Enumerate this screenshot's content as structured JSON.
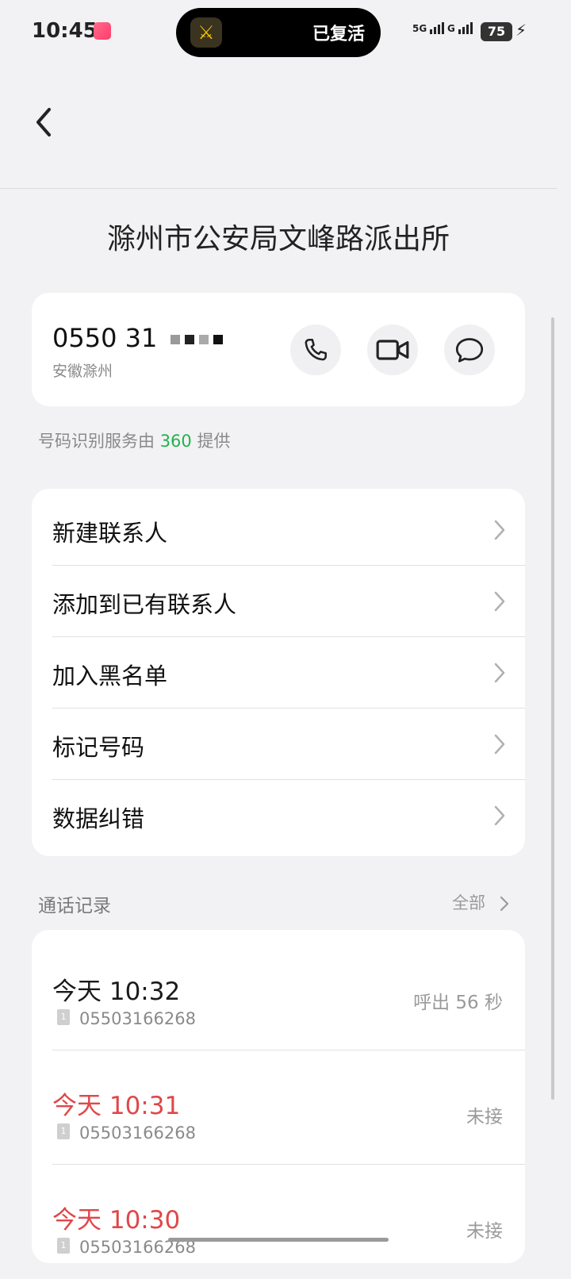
{
  "status_bar": {
    "time": "10:45",
    "signal1_label": "5G",
    "signal2_label": "G",
    "battery": "75"
  },
  "dynamic_island": {
    "icon": "sword-game-icon",
    "text": "已复活"
  },
  "header": {
    "title": "滁州市公安局文峰路派出所"
  },
  "number_card": {
    "number": "0550 31",
    "region": "安徽滁州",
    "actions": [
      "phone-icon",
      "video-icon",
      "message-icon"
    ]
  },
  "provider_note": {
    "prefix": "号码识别服务由",
    "brand": "360",
    "suffix": "提供"
  },
  "menu": [
    {
      "label": "新建联系人"
    },
    {
      "label": "添加到已有联系人"
    },
    {
      "label": "加入黑名单"
    },
    {
      "label": "标记号码"
    },
    {
      "label": "数据纠错"
    }
  ],
  "call_log": {
    "section_title": "通话记录",
    "all_label": "全部",
    "items": [
      {
        "time": "今天 10:32",
        "sim": "1",
        "number": "05503166268",
        "status": "呼出 56 秒",
        "missed": false
      },
      {
        "time": "今天 10:31",
        "sim": "1",
        "number": "05503166268",
        "status": "未接",
        "missed": true
      },
      {
        "time": "今天 10:30",
        "sim": "1",
        "number": "05503166268",
        "status": "未接",
        "missed": true
      }
    ]
  },
  "colors": {
    "accent_green": "#22b24c",
    "missed_red": "#e0474a",
    "background": "#f2f2f4"
  }
}
